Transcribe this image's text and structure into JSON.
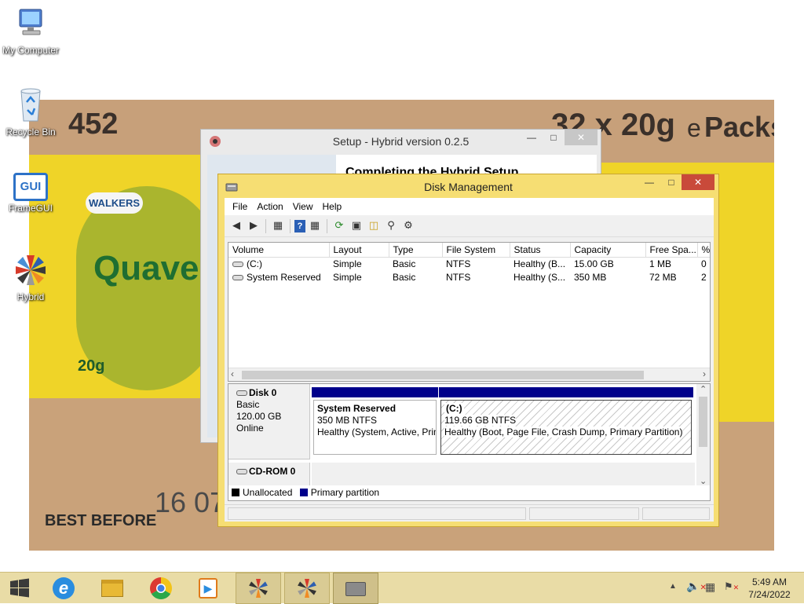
{
  "desktop": {
    "icons": [
      {
        "label": "My Computer",
        "icon": "computer-icon"
      },
      {
        "label": "Recycle Bin",
        "icon": "recycle-bin-icon"
      },
      {
        "label": "FrameGUI",
        "icon": "framegui-icon",
        "badge": "GUI"
      },
      {
        "label": "Hybrid",
        "icon": "hybrid-icon"
      }
    ],
    "wallpaper": {
      "texts": [
        "452",
        "32 x 20g",
        "e",
        "Packs",
        "WALKERS",
        "Quaver",
        "20g",
        "16 07",
        "BEST BEFORE"
      ]
    }
  },
  "setup_window": {
    "title": "Setup - Hybrid version 0.2.5",
    "heading": "Completing the Hybrid Setup"
  },
  "disk_mgmt": {
    "title": "Disk Management",
    "menu": [
      "File",
      "Action",
      "View",
      "Help"
    ],
    "toolbar": [
      "back-arrow-icon",
      "forward-arrow-icon",
      "console-tree-icon",
      "help-icon",
      "properties-pane-icon",
      "refresh-icon",
      "properties-icon",
      "open-folder-icon",
      "search-icon",
      "settings-icon"
    ],
    "columns": [
      "Volume",
      "Layout",
      "Type",
      "File System",
      "Status",
      "Capacity",
      "Free Spa...",
      "%"
    ],
    "rows": [
      [
        "(C:)",
        "Simple",
        "Basic",
        "NTFS",
        "Healthy (B...",
        "15.00 GB",
        "1 MB",
        "0"
      ],
      [
        "System Reserved",
        "Simple",
        "Basic",
        "NTFS",
        "Healthy (S...",
        "350 MB",
        "72 MB",
        "2"
      ]
    ],
    "disk0": {
      "name": "Disk 0",
      "type": "Basic",
      "size": "120.00 GB",
      "state": "Online",
      "partitions": [
        {
          "name": "System Reserved",
          "size": "350 MB NTFS",
          "status": "Healthy (System, Active, Primary Partition)"
        },
        {
          "name": "(C:)",
          "size": "119.66 GB NTFS",
          "status": "Healthy (Boot, Page File, Crash Dump, Primary Partition)"
        }
      ]
    },
    "cdrom": {
      "name": "CD-ROM 0"
    },
    "legend": [
      "Unallocated",
      "Primary partition"
    ],
    "legend_colors": {
      "unallocated": "#000000",
      "primary": "#00008b"
    }
  },
  "taskbar": {
    "time": "5:49 AM",
    "date": "7/24/2022",
    "items": [
      "windows-start-icon",
      "internet-explorer-icon",
      "file-explorer-icon",
      "chrome-icon",
      "media-player-icon",
      "hybrid-taskbar-icon",
      "hybrid-taskbar-icon-2",
      "disk-management-taskbar-icon"
    ]
  }
}
